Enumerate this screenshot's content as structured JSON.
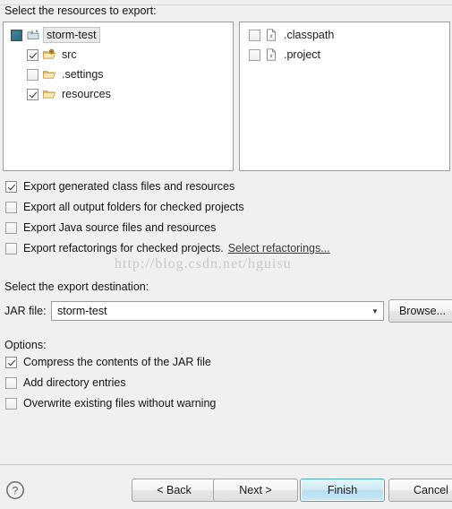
{
  "dialog": {
    "resources_label": "Select the resources to export:",
    "destination_label": "Select the export destination:",
    "options_label": "Options:",
    "jar_file_label": "JAR file:"
  },
  "watermark": "http://blog.csdn.net/hguisu",
  "resource_tree": {
    "nodes": [
      {
        "label": "storm-test",
        "icon": "java-project-icon",
        "check": "grayed",
        "indent": 0,
        "selected": true
      },
      {
        "label": "src",
        "icon": "source-folder-icon",
        "check": "checked",
        "indent": 1,
        "selected": false
      },
      {
        "label": ".settings",
        "icon": "folder-icon",
        "check": "empty",
        "indent": 1,
        "selected": false
      },
      {
        "label": "resources",
        "icon": "folder-icon",
        "check": "checked",
        "indent": 1,
        "selected": false
      }
    ]
  },
  "resource_files": {
    "nodes": [
      {
        "label": ".classpath",
        "icon": "xml-file-icon",
        "check": "empty"
      },
      {
        "label": ".project",
        "icon": "xml-file-icon",
        "check": "empty"
      }
    ]
  },
  "export_options": [
    {
      "label": "Export generated class files and resources",
      "check": "checked"
    },
    {
      "label": "Export all output folders for checked projects",
      "check": "empty"
    },
    {
      "label": "Export Java source files and resources",
      "check": "empty"
    },
    {
      "label": "Export refactorings for checked projects.",
      "check": "empty",
      "link": "Select refactorings..."
    }
  ],
  "destination": {
    "jar_file_value": "storm-test",
    "jar_file_placeholder": "",
    "browse_label": "Browse..."
  },
  "options": [
    {
      "label": "Compress the contents of the JAR file",
      "check": "checked"
    },
    {
      "label": "Add directory entries",
      "check": "empty"
    },
    {
      "label": "Overwrite existing files without warning",
      "check": "empty"
    }
  ],
  "footer": {
    "help_icon": "help-icon",
    "back_label": "< Back",
    "next_label": "Next >",
    "finish_label": "Finish",
    "cancel_label": "Cancel"
  },
  "colors": {
    "dialog_background": "#f0f0f0",
    "panel_background": "#ffffff",
    "panel_border": "#9a9a9e",
    "finish_accent": "#4aa8bf",
    "grayed_check": "#2f6f86",
    "folder_icon": "#f0b64b",
    "watermark": "#c9c9c9"
  }
}
